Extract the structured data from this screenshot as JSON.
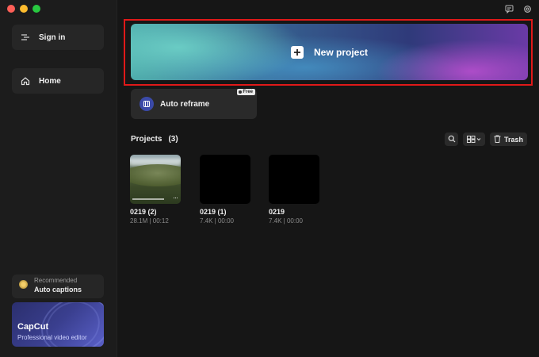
{
  "sidebar": {
    "sign_in_label": "Sign in",
    "home_label": "Home",
    "recommended": {
      "kicker": "Recommended",
      "title": "Auto captions"
    },
    "promo": {
      "title": "CapCut",
      "subtitle": "Professional video editor"
    }
  },
  "banner": {
    "label": "New project"
  },
  "auto_reframe": {
    "label": "Auto reframe",
    "badge": "Free"
  },
  "projects": {
    "title": "Projects",
    "count": "(3)",
    "trash_label": "Trash",
    "items": [
      {
        "name": "0219 (2)",
        "meta": "28.1M | 00:12",
        "more": "···"
      },
      {
        "name": "0219 (1)",
        "meta": "7.4K | 00:00"
      },
      {
        "name": "0219",
        "meta": "7.4K | 00:00"
      }
    ]
  },
  "colors": {
    "highlight": "#e01919",
    "accent": "#3b4aa8",
    "background": "#161616"
  },
  "icons": [
    "sign-in-icon",
    "home-icon",
    "bulb-icon",
    "chat-icon",
    "settings-icon",
    "plus-icon",
    "reframe-icon",
    "search-icon",
    "grid-view-icon",
    "trash-icon",
    "more-icon"
  ]
}
